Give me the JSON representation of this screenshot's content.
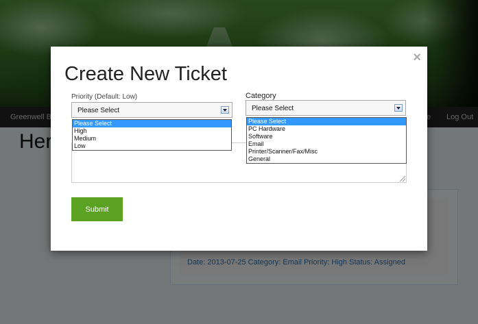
{
  "navbar": {
    "brand": "Greenwell B",
    "right_partial": "ne",
    "logout_label": "Log Out"
  },
  "page": {
    "heading": "Her",
    "ticket_meta": "Date: 2013-07-25 Category: Email Priority: High Status: Assigned"
  },
  "modal": {
    "close_glyph": "×",
    "title": "Create New Ticket",
    "priority": {
      "label": "Priority (Default: Low)",
      "selected": "Please Select",
      "options": [
        "Please Select",
        "High",
        "Medium",
        "Low"
      ]
    },
    "category": {
      "label": "Category",
      "selected": "Please Select",
      "options": [
        "Please Select",
        "PC Hardware",
        "Software",
        "Email",
        "Printer/Scanner/Fax/Misc",
        "General"
      ]
    },
    "submit_label": "Submit"
  },
  "colors": {
    "submit_bg": "#5ba222",
    "highlight": "#3399ff",
    "link": "#2a6cb0",
    "navbar_bg": "#222222"
  }
}
